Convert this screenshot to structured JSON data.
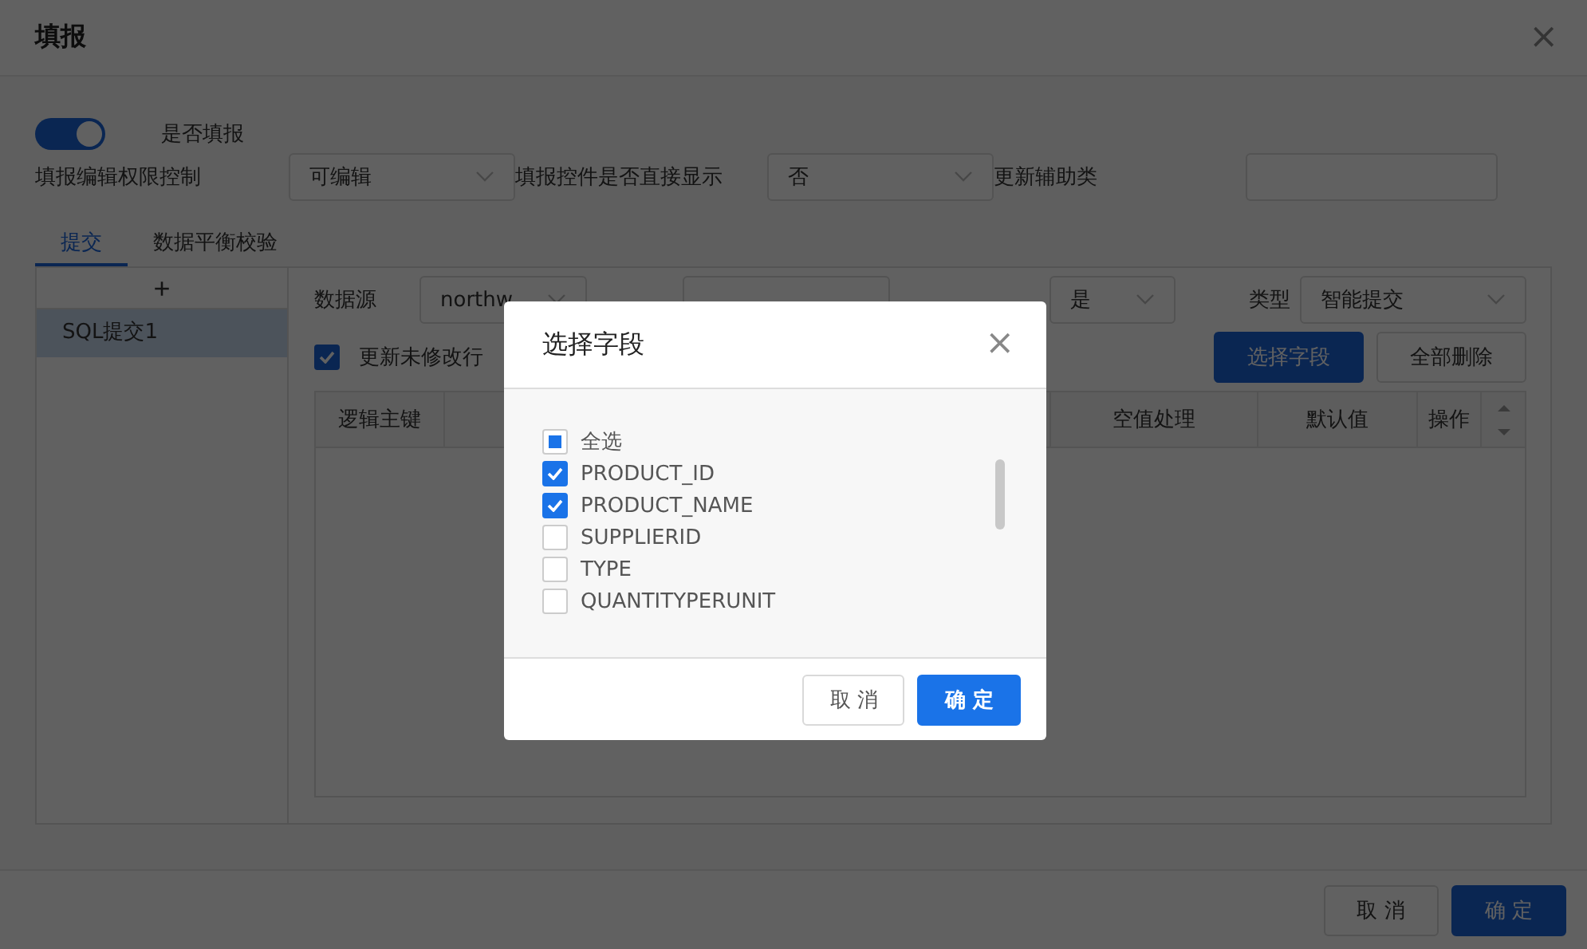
{
  "window": {
    "title": "填报",
    "close": "×"
  },
  "fill_toggle": {
    "label": "是否填报",
    "on": true
  },
  "settings": [
    {
      "label": "填报编辑权限控制",
      "kind": "select",
      "value": "可编辑"
    },
    {
      "label": "填报控件是否直接显示",
      "kind": "select",
      "value": "否"
    },
    {
      "label": "更新辅助类",
      "kind": "input"
    }
  ],
  "tabs": [
    {
      "label": "提交",
      "selected": true
    },
    {
      "label": "数据平衡校验",
      "selected": false
    }
  ],
  "sidebar": {
    "add": "+",
    "items": [
      {
        "label": "SQL提交1",
        "selected": true
      }
    ]
  },
  "filters": [
    {
      "kind": "select",
      "label": "数据源",
      "value": "northw"
    },
    {
      "kind": "covered"
    },
    {
      "kind": "select",
      "value": "是"
    },
    {
      "kind": "select",
      "label": "类型",
      "value": "智能提交"
    }
  ],
  "update_unmodified": {
    "label": "更新未修改行",
    "checked": true
  },
  "actions": [
    {
      "label": "选择字段",
      "kind": "primary"
    },
    {
      "label": "全部删除",
      "kind": "default"
    }
  ],
  "table": {
    "columns": [
      "逻辑主键",
      "空值处理",
      "默认值",
      "操作"
    ]
  },
  "footer_buttons": [
    {
      "label": "取 消",
      "kind": "default"
    },
    {
      "label": "确 定",
      "kind": "primary"
    }
  ],
  "modal": {
    "title": "选择字段",
    "close": "×",
    "select_all": {
      "label": "全选",
      "indeterminate": true
    },
    "fields": [
      {
        "label": "PRODUCT_ID",
        "checked": true
      },
      {
        "label": "PRODUCT_NAME",
        "checked": true
      },
      {
        "label": "SUPPLIERID",
        "checked": false
      },
      {
        "label": "TYPE",
        "checked": false
      },
      {
        "label": "QUANTITYPERUNIT",
        "checked": false
      }
    ],
    "buttons": [
      {
        "label": "取 消",
        "kind": "default"
      },
      {
        "label": "确 定",
        "kind": "primary"
      }
    ]
  }
}
